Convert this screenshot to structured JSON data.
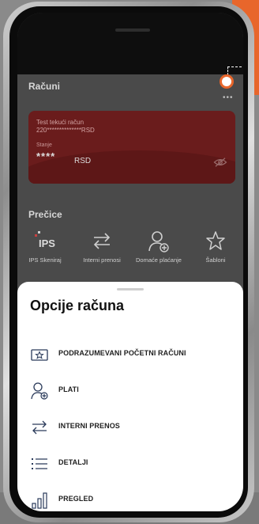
{
  "app": {
    "accounts_title": "Računi",
    "more_dots": "•••",
    "account_card": {
      "name": "Test tekući račun",
      "number": "220**************RSD",
      "balance_label": "Stanje",
      "balance_masked": "****",
      "currency": "RSD"
    },
    "shortcuts_title": "Prečice",
    "shortcuts": [
      {
        "label": "IPS Skeniraj",
        "icon": "ips-icon"
      },
      {
        "label": "Interni prenosi",
        "icon": "transfer-arrows-icon"
      },
      {
        "label": "Domaće plaćanje",
        "icon": "person-add-icon"
      },
      {
        "label": "Šabloni",
        "icon": "star-icon"
      }
    ]
  },
  "sheet": {
    "title": "Opcije računa",
    "options": [
      {
        "label": "PODRAZUMEVANI POČETNI RAČUNI",
        "icon": "star-card-icon"
      },
      {
        "label": "PLATI",
        "icon": "person-add-icon"
      },
      {
        "label": "INTERNI PRENOS",
        "icon": "transfer-arrows-icon"
      },
      {
        "label": "DETALJI",
        "icon": "list-icon"
      },
      {
        "label": "PREGLED",
        "icon": "bar-chart-icon"
      }
    ]
  },
  "colors": {
    "accent_orange": "#e8662b",
    "card_red": "#6a1c1c",
    "sheet_bg": "#ffffff"
  }
}
